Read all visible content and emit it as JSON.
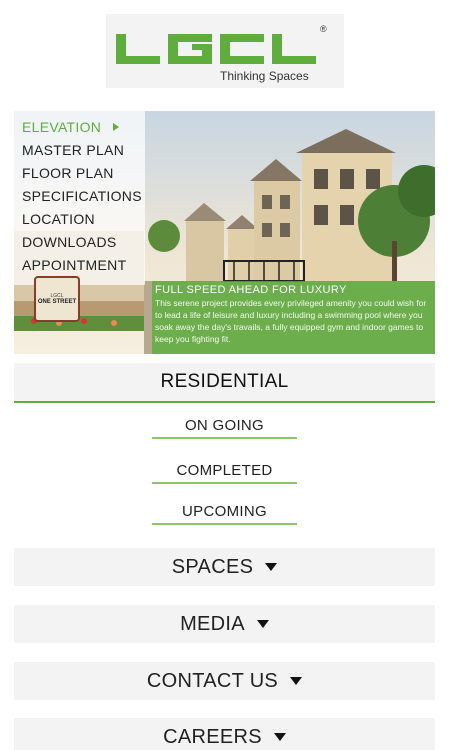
{
  "logo": {
    "brand": "LGCL",
    "registered": "®",
    "tagline": "Thinking Spaces"
  },
  "hero": {
    "menu": [
      {
        "label": "ELEVATION",
        "active": true
      },
      {
        "label": "MASTER PLAN",
        "active": false
      },
      {
        "label": "FLOOR PLAN",
        "active": false
      },
      {
        "label": "SPECIFICATIONS",
        "active": false
      },
      {
        "label": "LOCATION",
        "active": false
      },
      {
        "label": "DOWNLOADS",
        "active": false
      },
      {
        "label": "APPOINTMENT",
        "active": false
      }
    ],
    "badge": {
      "small": "LGCL",
      "text": "ONE STREET"
    },
    "overlay": {
      "title": "FULL SPEED AHEAD FOR LUXURY",
      "body": "This serene project provides every privileged amenity you could wish for to lead a life of leisure and luxury including a swimming pool where you soak away the day's travails, a fully equipped gym and indoor games to keep you fighting fit."
    }
  },
  "residential": {
    "title": "RESIDENTIAL",
    "links": [
      {
        "label": "ON GOING"
      },
      {
        "label": "COMPLETED"
      },
      {
        "label": "UPCOMING"
      }
    ]
  },
  "sections": [
    {
      "label": "SPACES"
    },
    {
      "label": "MEDIA"
    },
    {
      "label": "CONTACT US"
    },
    {
      "label": "CAREERS"
    }
  ],
  "colors": {
    "accent": "#5fae3d",
    "panel": "#f3f3f3",
    "text": "#222222"
  },
  "icons": {
    "menu_arrow": "arrow-right-icon",
    "section_caret": "caret-down-icon"
  }
}
